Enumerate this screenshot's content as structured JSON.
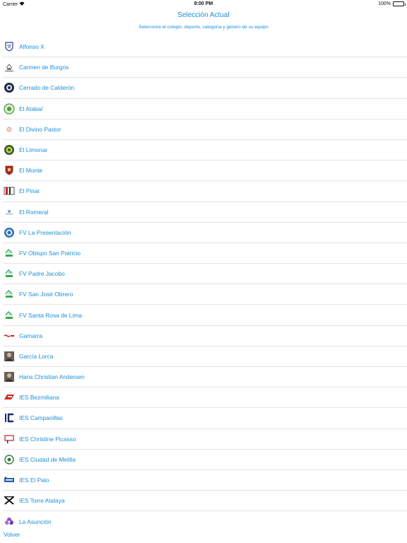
{
  "status_bar": {
    "carrier": "Carrier",
    "time": "8:00 PM",
    "battery": "100%"
  },
  "header": {
    "title": "Selección Actual",
    "subtitle": "Seleccione el colegio, deporte, categoría y género de su equipo"
  },
  "schools": [
    {
      "name": "Alfonso X",
      "icon": "shield-crest-icon"
    },
    {
      "name": "Carmen de Burgos",
      "icon": "building-logo-icon"
    },
    {
      "name": "Cerrado de Calderón",
      "icon": "round-seal-icon"
    },
    {
      "name": "El Atabal",
      "icon": "green-wreath-icon"
    },
    {
      "name": "El Divino Pastor",
      "icon": "small-emblem-icon"
    },
    {
      "name": "El Limonar",
      "icon": "green-badge-icon"
    },
    {
      "name": "El Monte",
      "icon": "red-shield-icon"
    },
    {
      "name": "El Pinar",
      "icon": "red-stripes-icon"
    },
    {
      "name": "El Romeral",
      "icon": "small-text-logo-icon"
    },
    {
      "name": "FV La Presentación",
      "icon": "blue-seal-icon"
    },
    {
      "name": "FV Obispo San Patricio",
      "icon": "fv-triangle-icon"
    },
    {
      "name": "FV Padre Jacobo",
      "icon": "fv-triangle-icon"
    },
    {
      "name": "FV San José Obrero",
      "icon": "fv-triangle-icon"
    },
    {
      "name": "FV Santa Rosa de Lima",
      "icon": "fv-triangle-icon"
    },
    {
      "name": "Gamarra",
      "icon": "red-text-logo-icon"
    },
    {
      "name": "García Lorca",
      "icon": "portrait-photo-icon"
    },
    {
      "name": "Hans Christian Andersen",
      "icon": "portrait-photo-icon"
    },
    {
      "name": "IES Bezmiliana",
      "icon": "red-block-logo-icon"
    },
    {
      "name": "IES Campanillas",
      "icon": "blue-c-logo-icon"
    },
    {
      "name": "IES Christine Picasso",
      "icon": "outline-square-logo-icon"
    },
    {
      "name": "IES Ciudad de Melilla",
      "icon": "green-ring-logo-icon"
    },
    {
      "name": "IES El Palo",
      "icon": "blue-banner-logo-icon"
    },
    {
      "name": "IES Torre Atalaya",
      "icon": "black-x-logo-icon"
    },
    {
      "name": "La Asunción",
      "icon": "purple-flower-icon"
    }
  ],
  "footer": {
    "back_label": "Volver"
  },
  "colors": {
    "accent": "#1a8fd6",
    "divider": "#e4e4e4"
  }
}
